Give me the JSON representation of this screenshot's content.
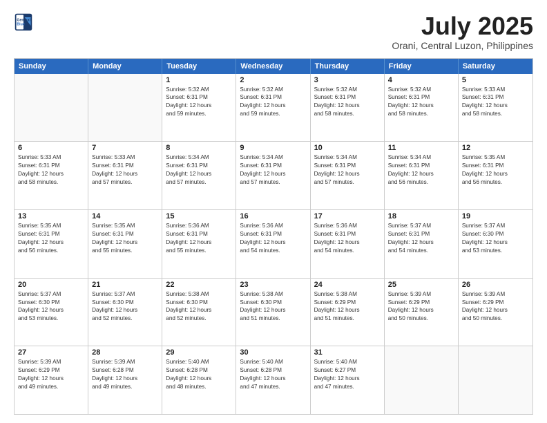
{
  "header": {
    "logo_line1": "General",
    "logo_line2": "Blue",
    "month": "July 2025",
    "location": "Orani, Central Luzon, Philippines"
  },
  "days_of_week": [
    "Sunday",
    "Monday",
    "Tuesday",
    "Wednesday",
    "Thursday",
    "Friday",
    "Saturday"
  ],
  "weeks": [
    [
      {
        "day": "",
        "info": ""
      },
      {
        "day": "",
        "info": ""
      },
      {
        "day": "1",
        "info": "Sunrise: 5:32 AM\nSunset: 6:31 PM\nDaylight: 12 hours\nand 59 minutes."
      },
      {
        "day": "2",
        "info": "Sunrise: 5:32 AM\nSunset: 6:31 PM\nDaylight: 12 hours\nand 59 minutes."
      },
      {
        "day": "3",
        "info": "Sunrise: 5:32 AM\nSunset: 6:31 PM\nDaylight: 12 hours\nand 58 minutes."
      },
      {
        "day": "4",
        "info": "Sunrise: 5:32 AM\nSunset: 6:31 PM\nDaylight: 12 hours\nand 58 minutes."
      },
      {
        "day": "5",
        "info": "Sunrise: 5:33 AM\nSunset: 6:31 PM\nDaylight: 12 hours\nand 58 minutes."
      }
    ],
    [
      {
        "day": "6",
        "info": "Sunrise: 5:33 AM\nSunset: 6:31 PM\nDaylight: 12 hours\nand 58 minutes."
      },
      {
        "day": "7",
        "info": "Sunrise: 5:33 AM\nSunset: 6:31 PM\nDaylight: 12 hours\nand 57 minutes."
      },
      {
        "day": "8",
        "info": "Sunrise: 5:34 AM\nSunset: 6:31 PM\nDaylight: 12 hours\nand 57 minutes."
      },
      {
        "day": "9",
        "info": "Sunrise: 5:34 AM\nSunset: 6:31 PM\nDaylight: 12 hours\nand 57 minutes."
      },
      {
        "day": "10",
        "info": "Sunrise: 5:34 AM\nSunset: 6:31 PM\nDaylight: 12 hours\nand 57 minutes."
      },
      {
        "day": "11",
        "info": "Sunrise: 5:34 AM\nSunset: 6:31 PM\nDaylight: 12 hours\nand 56 minutes."
      },
      {
        "day": "12",
        "info": "Sunrise: 5:35 AM\nSunset: 6:31 PM\nDaylight: 12 hours\nand 56 minutes."
      }
    ],
    [
      {
        "day": "13",
        "info": "Sunrise: 5:35 AM\nSunset: 6:31 PM\nDaylight: 12 hours\nand 56 minutes."
      },
      {
        "day": "14",
        "info": "Sunrise: 5:35 AM\nSunset: 6:31 PM\nDaylight: 12 hours\nand 55 minutes."
      },
      {
        "day": "15",
        "info": "Sunrise: 5:36 AM\nSunset: 6:31 PM\nDaylight: 12 hours\nand 55 minutes."
      },
      {
        "day": "16",
        "info": "Sunrise: 5:36 AM\nSunset: 6:31 PM\nDaylight: 12 hours\nand 54 minutes."
      },
      {
        "day": "17",
        "info": "Sunrise: 5:36 AM\nSunset: 6:31 PM\nDaylight: 12 hours\nand 54 minutes."
      },
      {
        "day": "18",
        "info": "Sunrise: 5:37 AM\nSunset: 6:31 PM\nDaylight: 12 hours\nand 54 minutes."
      },
      {
        "day": "19",
        "info": "Sunrise: 5:37 AM\nSunset: 6:30 PM\nDaylight: 12 hours\nand 53 minutes."
      }
    ],
    [
      {
        "day": "20",
        "info": "Sunrise: 5:37 AM\nSunset: 6:30 PM\nDaylight: 12 hours\nand 53 minutes."
      },
      {
        "day": "21",
        "info": "Sunrise: 5:37 AM\nSunset: 6:30 PM\nDaylight: 12 hours\nand 52 minutes."
      },
      {
        "day": "22",
        "info": "Sunrise: 5:38 AM\nSunset: 6:30 PM\nDaylight: 12 hours\nand 52 minutes."
      },
      {
        "day": "23",
        "info": "Sunrise: 5:38 AM\nSunset: 6:30 PM\nDaylight: 12 hours\nand 51 minutes."
      },
      {
        "day": "24",
        "info": "Sunrise: 5:38 AM\nSunset: 6:29 PM\nDaylight: 12 hours\nand 51 minutes."
      },
      {
        "day": "25",
        "info": "Sunrise: 5:39 AM\nSunset: 6:29 PM\nDaylight: 12 hours\nand 50 minutes."
      },
      {
        "day": "26",
        "info": "Sunrise: 5:39 AM\nSunset: 6:29 PM\nDaylight: 12 hours\nand 50 minutes."
      }
    ],
    [
      {
        "day": "27",
        "info": "Sunrise: 5:39 AM\nSunset: 6:29 PM\nDaylight: 12 hours\nand 49 minutes."
      },
      {
        "day": "28",
        "info": "Sunrise: 5:39 AM\nSunset: 6:28 PM\nDaylight: 12 hours\nand 49 minutes."
      },
      {
        "day": "29",
        "info": "Sunrise: 5:40 AM\nSunset: 6:28 PM\nDaylight: 12 hours\nand 48 minutes."
      },
      {
        "day": "30",
        "info": "Sunrise: 5:40 AM\nSunset: 6:28 PM\nDaylight: 12 hours\nand 47 minutes."
      },
      {
        "day": "31",
        "info": "Sunrise: 5:40 AM\nSunset: 6:27 PM\nDaylight: 12 hours\nand 47 minutes."
      },
      {
        "day": "",
        "info": ""
      },
      {
        "day": "",
        "info": ""
      }
    ]
  ]
}
